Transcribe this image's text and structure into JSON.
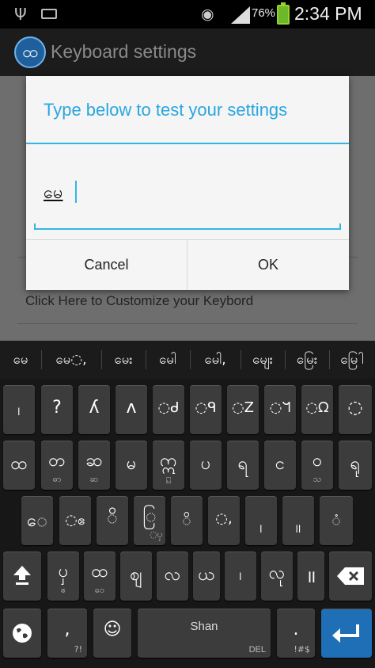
{
  "status_bar": {
    "battery_percent": "76%",
    "time": "2:34 PM",
    "icons": [
      "usb-icon",
      "keyboard-icon",
      "eye-icon",
      "signal-icon",
      "battery-charging-icon"
    ]
  },
  "app_bar": {
    "logo_glyph": "ထ",
    "title": "Keyboard settings"
  },
  "background": {
    "customize_link": "Click Here to Customize your Keybord"
  },
  "dialog": {
    "title": "Type below to test your settings",
    "input_value": "မေ",
    "cancel_label": "Cancel",
    "ok_label": "OK"
  },
  "suggestions": [
    "မေ",
    "မေ◌,",
    "မေး",
    "မေါ",
    "မေါ,",
    "မျေး",
    "မြေး",
    "မြေါ"
  ],
  "keyboard": {
    "row1": [
      {
        "main": "၊",
        "hint": ""
      },
      {
        "main": "?",
        "hint": ""
      },
      {
        "main": "ʎ",
        "hint": ""
      },
      {
        "main": "ʌ",
        "hint": ""
      },
      {
        "main": "◌ᑯ",
        "hint": ""
      },
      {
        "main": "◌ᑫ",
        "hint": ""
      },
      {
        "main": "◌Z",
        "hint": ""
      },
      {
        "main": "◌ᖻ",
        "hint": ""
      },
      {
        "main": "◌ᘯ",
        "hint": ""
      },
      {
        "main": "◌",
        "hint": ""
      }
    ],
    "row2": [
      {
        "main": "ထ",
        "hint": ""
      },
      {
        "main": "တ",
        "hint": "ဓာ"
      },
      {
        "main": "ဆ",
        "hint": "ဆ"
      },
      {
        "main": "မ",
        "hint": ""
      },
      {
        "main": "ဣ",
        "hint": "⍇"
      },
      {
        "main": "ပ",
        "hint": ""
      },
      {
        "main": "ရ",
        "hint": ""
      },
      {
        "main": "င",
        "hint": ""
      },
      {
        "main": "ဝ",
        "hint": "သ"
      },
      {
        "main": "ရု",
        "hint": ""
      }
    ],
    "row3": [
      {
        "main": "ေ",
        "hint": ""
      },
      {
        "main": "◌ဧ",
        "hint": ""
      },
      {
        "main": "ိ",
        "hint": ""
      },
      {
        "main": "ြ",
        "hint": "◌ၦ"
      },
      {
        "main": "◌ိ",
        "hint": ""
      },
      {
        "main": "◌,",
        "hint": ""
      },
      {
        "main": "၊",
        "hint": ""
      },
      {
        "main": "။",
        "hint": ""
      },
      {
        "main": "◌ံ",
        "hint": ""
      }
    ],
    "row4": [
      {
        "main": "ၦ",
        "hint": "ဧ"
      },
      {
        "main": "ထ",
        "hint": "ဝေ"
      },
      {
        "main": "ဈ",
        "hint": ""
      },
      {
        "main": "လ",
        "hint": ""
      },
      {
        "main": "ယ",
        "hint": ""
      },
      {
        "main": "၊",
        "hint": ""
      },
      {
        "main": "လု",
        "hint": ""
      },
      {
        "main": "॥",
        "hint": ""
      }
    ],
    "bottom": {
      "comma_main": ",",
      "comma_hint": "?!",
      "emoji_main": "☺",
      "space_label": "Shan",
      "space_hint": "DEL",
      "period_main": ".",
      "period_hint": "!#$"
    }
  },
  "colors": {
    "accent": "#33b5e5",
    "dialog_title": "#2aa6e0",
    "enter_key": "#1e6fb5",
    "battery": "#6bb82a"
  }
}
